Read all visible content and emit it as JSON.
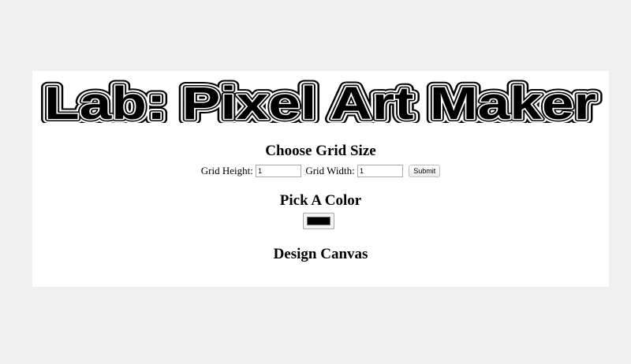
{
  "app": {
    "title": "Lab: Pixel Art Maker"
  },
  "grid_size": {
    "heading": "Choose Grid Size",
    "height_label": "Grid Height:",
    "height_value": "1",
    "width_label": "Grid Width:",
    "width_value": "1",
    "submit_label": "Submit"
  },
  "color": {
    "heading": "Pick A Color",
    "selected_color": "#000000"
  },
  "canvas": {
    "heading": "Design Canvas"
  },
  "colors": {
    "page_background": "#efefef",
    "panel_background": "#ffffff",
    "text": "#000000"
  }
}
